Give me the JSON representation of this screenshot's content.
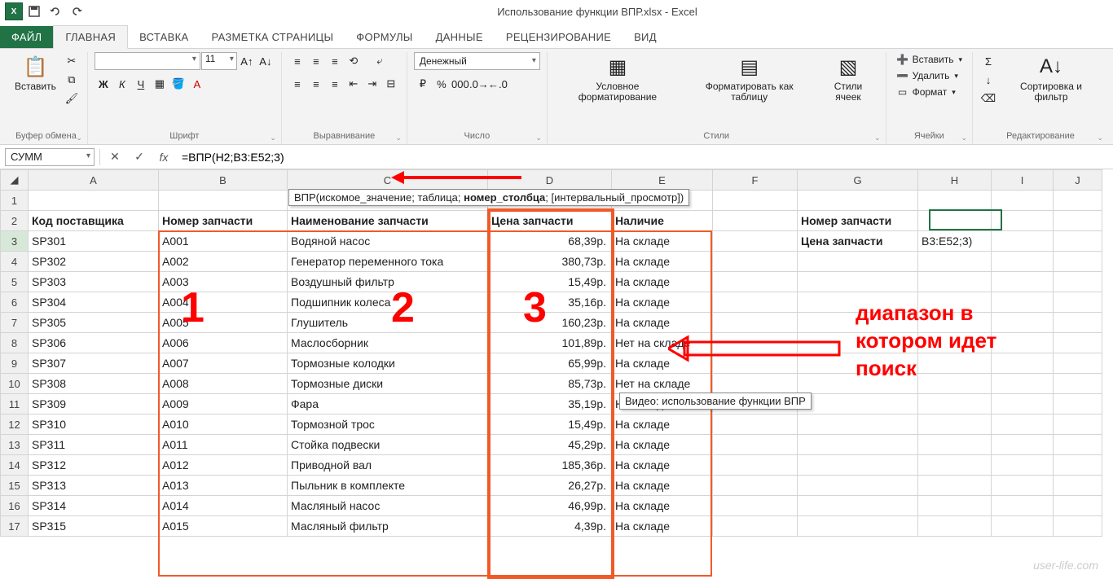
{
  "window": {
    "title": "Использование функции ВПР.xlsx - Excel"
  },
  "tabs": {
    "file": "ФАЙЛ",
    "items": [
      "ГЛАВНАЯ",
      "ВСТАВКА",
      "РАЗМЕТКА СТРАНИЦЫ",
      "ФОРМУЛЫ",
      "ДАННЫЕ",
      "РЕЦЕНЗИРОВАНИЕ",
      "ВИД"
    ],
    "active": 0
  },
  "ribbon": {
    "clipboard": {
      "paste": "Вставить",
      "label": "Буфер обмена"
    },
    "font": {
      "name": "",
      "size": "11",
      "label": "Шрифт"
    },
    "align": {
      "label": "Выравнивание"
    },
    "number": {
      "format": "Денежный",
      "label": "Число"
    },
    "styles": {
      "cond": "Условное форматирование",
      "fmt_table": "Форматировать как таблицу",
      "cell_styles": "Стили ячеек",
      "label": "Стили"
    },
    "cells": {
      "insert": "Вставить",
      "delete": "Удалить",
      "format": "Формат",
      "label": "Ячейки"
    },
    "editing": {
      "sort": "Сортировка и фильтр",
      "label": "Редактирование"
    }
  },
  "formula_bar": {
    "name_box": "СУММ",
    "formula": "=ВПР(H2;B3:E52;3)"
  },
  "func_hint": "ВПР(искомое_значение; таблица; номер_столбца; [интервальный_просмотр])",
  "tooltip": "Видео: использование функции ВПР",
  "columns": [
    "A",
    "B",
    "C",
    "D",
    "E",
    "F",
    "G",
    "H",
    "I",
    "J"
  ],
  "headers": {
    "a": "Код поставщика",
    "b": "Номер запчасти",
    "c": "Наименование запчасти",
    "d": "Цена запчасти",
    "e": "Наличие",
    "g": "Номер запчасти",
    "g2": "Цена запчасти",
    "h3": "B3:E52;3)"
  },
  "rows": [
    {
      "n": 1
    },
    {
      "n": 2,
      "a": "Код поставщика",
      "b": "Номер запчасти",
      "c": "Наименование запчасти",
      "d": "Цена запчасти",
      "e": "Наличие",
      "g": "Номер запчасти"
    },
    {
      "n": 3,
      "a": "SP301",
      "b": "A001",
      "c": "Водяной насос",
      "d": "68,39р.",
      "e": "На складе",
      "g": "Цена запчасти",
      "h": "B3:E52;3)"
    },
    {
      "n": 4,
      "a": "SP302",
      "b": "A002",
      "c": "Генератор переменного тока",
      "d": "380,73р.",
      "e": "На складе"
    },
    {
      "n": 5,
      "a": "SP303",
      "b": "A003",
      "c": "Воздушный фильтр",
      "d": "15,49р.",
      "e": "На складе"
    },
    {
      "n": 6,
      "a": "SP304",
      "b": "A004",
      "c": "Подшипник колеса",
      "d": "35,16р.",
      "e": "На складе"
    },
    {
      "n": 7,
      "a": "SP305",
      "b": "A005",
      "c": "Глушитель",
      "d": "160,23р.",
      "e": "На складе"
    },
    {
      "n": 8,
      "a": "SP306",
      "b": "A006",
      "c": "Маслосборник",
      "d": "101,89р.",
      "e": "Нет на складе"
    },
    {
      "n": 9,
      "a": "SP307",
      "b": "A007",
      "c": "Тормозные колодки",
      "d": "65,99р.",
      "e": "На складе"
    },
    {
      "n": 10,
      "a": "SP308",
      "b": "A008",
      "c": "Тормозные диски",
      "d": "85,73р.",
      "e": "Нет на складе"
    },
    {
      "n": 11,
      "a": "SP309",
      "b": "A009",
      "c": "Фара",
      "d": "35,19р.",
      "e": "На складе"
    },
    {
      "n": 12,
      "a": "SP310",
      "b": "A010",
      "c": "Тормозной трос",
      "d": "15,49р.",
      "e": "На складе"
    },
    {
      "n": 13,
      "a": "SP311",
      "b": "A011",
      "c": "Стойка подвески",
      "d": "45,29р.",
      "e": "На складе"
    },
    {
      "n": 14,
      "a": "SP312",
      "b": "A012",
      "c": "Приводной вал",
      "d": "185,36р.",
      "e": "На складе"
    },
    {
      "n": 15,
      "a": "SP313",
      "b": "A013",
      "c": "Пыльник в комплекте",
      "d": "26,27р.",
      "e": "На складе"
    },
    {
      "n": 16,
      "a": "SP314",
      "b": "A014",
      "c": "Масляный насос",
      "d": "46,99р.",
      "e": "На складе"
    },
    {
      "n": 17,
      "a": "SP315",
      "b": "A015",
      "c": "Масляный фильтр",
      "d": "4,39р.",
      "e": "На складе"
    }
  ],
  "annotations": {
    "n1": "1",
    "n2": "2",
    "n3": "3",
    "text": "диапазон в котором идет поиск"
  },
  "watermark": "user-life.com"
}
